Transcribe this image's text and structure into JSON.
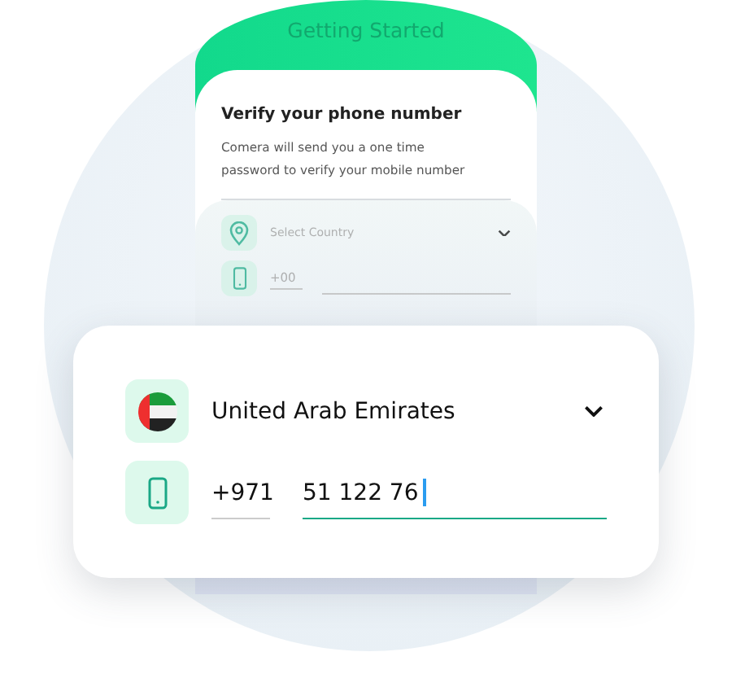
{
  "header": {
    "title": "Getting Started"
  },
  "verify": {
    "title": "Verify your phone number",
    "description": "Comera will send you a one time password to verify your mobile number",
    "country_field": {
      "placeholder": "Select Country"
    },
    "code_field": {
      "placeholder": "+00"
    }
  },
  "form": {
    "country": {
      "value": "United Arab Emirates"
    },
    "code": {
      "value": "+971"
    },
    "number": {
      "value": "51 122 76",
      "focused": true
    }
  }
}
